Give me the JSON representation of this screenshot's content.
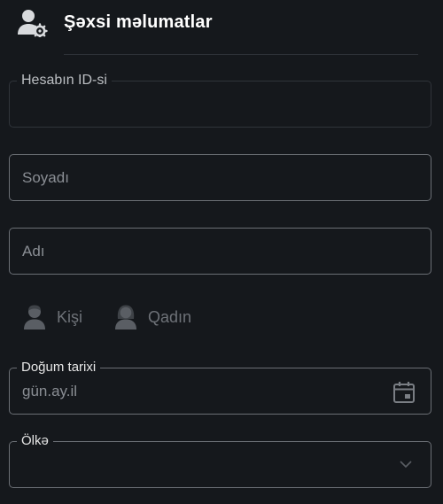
{
  "header": {
    "title": "Şəxsi məlumatlar",
    "icon": "user-settings-icon"
  },
  "fields": {
    "account_id": {
      "label": "Hesabın ID-si",
      "value": ""
    },
    "surname": {
      "placeholder": "Soyadı"
    },
    "name": {
      "placeholder": "Adı"
    },
    "birth_date": {
      "label": "Doğum tarixi",
      "placeholder": "gün.ay.il",
      "icon": "calendar-icon"
    },
    "country": {
      "label": "Ölkə",
      "value": "",
      "icon": "chevron-down-icon"
    }
  },
  "gender": {
    "options": [
      {
        "label": "Kişi",
        "icon": "male-user-icon"
      },
      {
        "label": "Qadın",
        "icon": "female-user-icon"
      }
    ]
  },
  "colors": {
    "background": "#15181c",
    "border": "#6b6f75",
    "muted_text": "#8a8e94"
  }
}
